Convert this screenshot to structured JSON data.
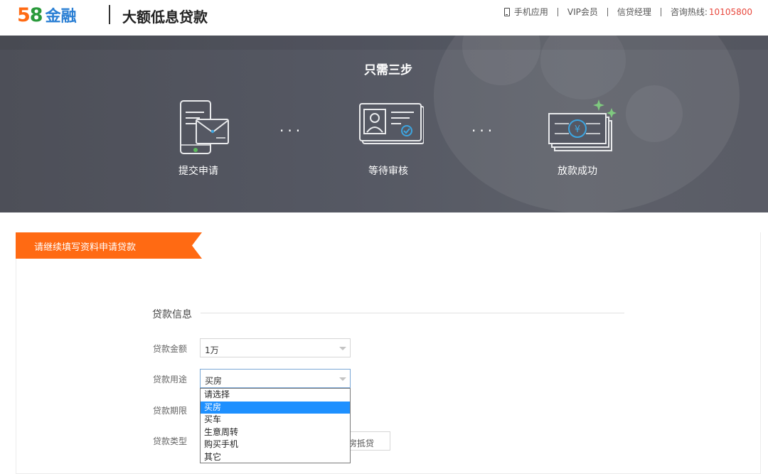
{
  "header": {
    "logo_number_1": "5",
    "logo_number_2": "8",
    "logo_word": "金融",
    "title": "大额低息贷款",
    "links": {
      "mobile_app": "手机应用",
      "vip": "VIP会员",
      "loan_manager": "信贷经理",
      "hotline_label": "咨询热线:",
      "hotline_number": "10105800"
    },
    "icons": {
      "mobile": "phone-icon"
    }
  },
  "banner": {
    "title": "只需三步",
    "steps": [
      {
        "label": "提交申请",
        "icon": "phone-envelope-icon"
      },
      {
        "label": "等待审核",
        "icon": "id-card-icon"
      },
      {
        "label": "放款成功",
        "icon": "money-bills-icon"
      }
    ],
    "separator": "···"
  },
  "form": {
    "ribbon_text": "请继续填写资料申请贷款",
    "section_title": "贷款信息",
    "fields": {
      "amount": {
        "label": "贷款金额",
        "value": "1万"
      },
      "purpose": {
        "label": "贷款用途",
        "value": "买房"
      },
      "term": {
        "label": "贷款期限"
      },
      "type": {
        "label": "贷款类型",
        "visible_option": "房抵贷"
      }
    },
    "purpose_options": [
      "请选择",
      "买房",
      "买车",
      "生意周转",
      "购买手机",
      "其它"
    ],
    "purpose_selected_index": 1
  },
  "colors": {
    "accent_orange": "#ff6a13",
    "hotline_red": "#e8473c",
    "select_highlight": "#1e90ff"
  }
}
